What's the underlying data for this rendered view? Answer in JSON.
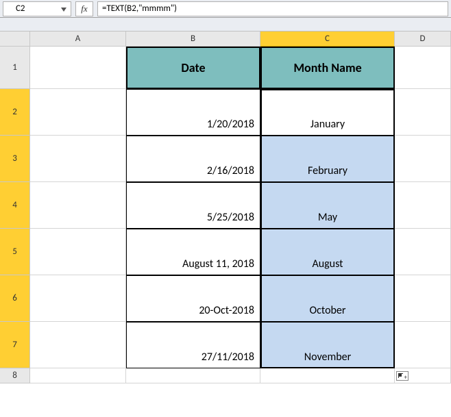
{
  "formula_bar": {
    "cell_ref": "C2",
    "fx_label": "fx",
    "formula": "=TEXT(B2,\"mmmm\")"
  },
  "columns": [
    "A",
    "B",
    "C",
    "D"
  ],
  "active_column": "C",
  "row_numbers": [
    "1",
    "2",
    "3",
    "4",
    "5",
    "6",
    "7",
    "8"
  ],
  "table": {
    "headers": {
      "date": "Date",
      "month": "Month Name"
    },
    "rows": [
      {
        "date": "1/20/2018",
        "month": "January"
      },
      {
        "date": "2/16/2018",
        "month": "February"
      },
      {
        "date": "5/25/2018",
        "month": "May"
      },
      {
        "date": "August 11, 2018",
        "month": "August"
      },
      {
        "date": "20-Oct-2018",
        "month": "October"
      },
      {
        "date": "27/11/2018",
        "month": "November"
      }
    ]
  },
  "chart_data": {
    "type": "table",
    "title": "",
    "columns": [
      "Date",
      "Month Name"
    ],
    "rows": [
      [
        "1/20/2018",
        "January"
      ],
      [
        "2/16/2018",
        "February"
      ],
      [
        "5/25/2018",
        "May"
      ],
      [
        "August 11, 2018",
        "August"
      ],
      [
        "20-Oct-2018",
        "October"
      ],
      [
        "27/11/2018",
        "November"
      ]
    ]
  },
  "colors": {
    "header_bg": "#7ebebe",
    "selection_fill": "#c5d9f1",
    "active_header": "#ffcf33"
  }
}
